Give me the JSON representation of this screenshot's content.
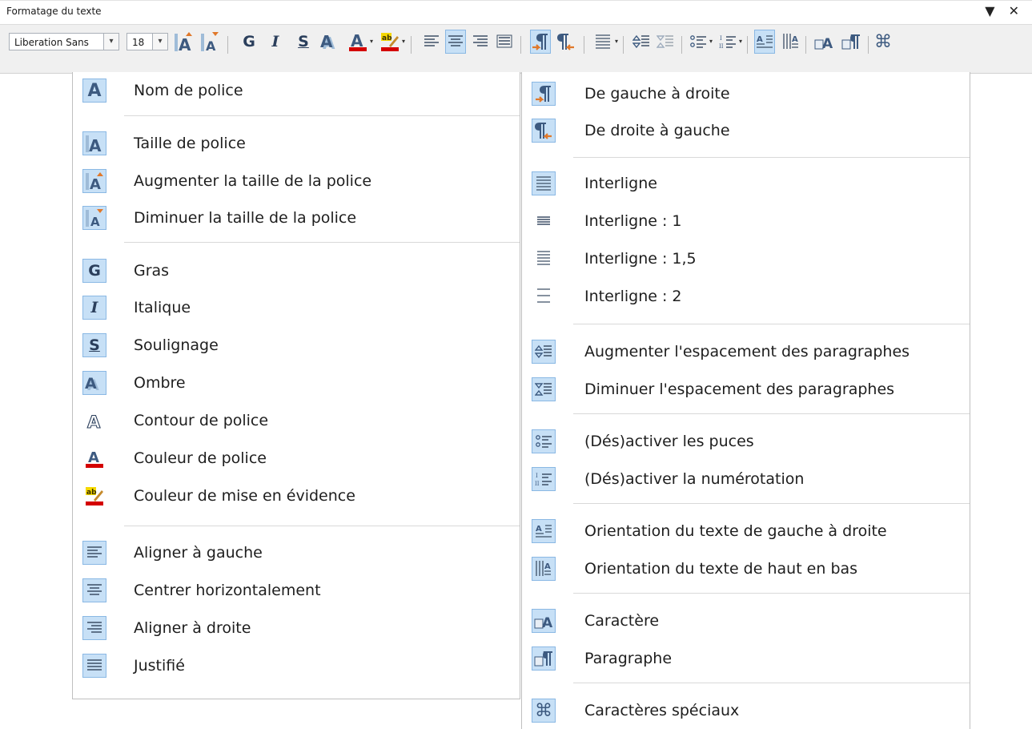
{
  "window": {
    "title": "Formatage du texte",
    "controls": "▼ ✕"
  },
  "toolbar": {
    "font_name": "Liberation Sans",
    "font_size": "18",
    "dropdown_glyph": "⌄",
    "bold": "G",
    "italic": "I",
    "underline": "S"
  },
  "colors": {
    "accent_bg": "#c7e0f6",
    "accent_border": "#8ab8e4",
    "icon": "#2b3f5c",
    "font_color_bar": "#d40000",
    "highlight": "#f5d800"
  },
  "left_menu": [
    {
      "label": "Nom de police",
      "icon": "font-name-icon"
    },
    {
      "label": "Taille de police",
      "icon": "font-size-icon"
    },
    {
      "label": "Augmenter la taille de la police",
      "icon": "grow-font-icon"
    },
    {
      "label": "Diminuer la taille de la police",
      "icon": "shrink-font-icon"
    },
    {
      "label": "Gras",
      "icon": "bold-icon"
    },
    {
      "label": "Italique",
      "icon": "italic-icon"
    },
    {
      "label": "Soulignage",
      "icon": "underline-icon"
    },
    {
      "label": "Ombre",
      "icon": "shadow-icon"
    },
    {
      "label": "Contour de police",
      "icon": "outline-font-icon"
    },
    {
      "label": "Couleur de police",
      "icon": "font-color-icon"
    },
    {
      "label": "Couleur de mise en évidence",
      "icon": "highlight-color-icon"
    },
    {
      "label": "Aligner à gauche",
      "icon": "align-left-icon"
    },
    {
      "label": "Centrer horizontalement",
      "icon": "align-center-icon"
    },
    {
      "label": "Aligner à droite",
      "icon": "align-right-icon"
    },
    {
      "label": "Justifié",
      "icon": "justify-icon"
    }
  ],
  "right_menu": [
    {
      "label": "De gauche à droite",
      "icon": "ltr-paragraph-icon"
    },
    {
      "label": "De droite à gauche",
      "icon": "rtl-paragraph-icon"
    },
    {
      "label": "Interligne",
      "icon": "line-spacing-icon"
    },
    {
      "label": "Interligne : 1",
      "icon": "line-spacing-1-icon"
    },
    {
      "label": "Interligne : 1,5",
      "icon": "line-spacing-15-icon"
    },
    {
      "label": "Interligne : 2",
      "icon": "line-spacing-2-icon"
    },
    {
      "label": "Augmenter l'espacement des paragraphes",
      "icon": "increase-paragraph-spacing-icon"
    },
    {
      "label": "Diminuer l'espacement des paragraphes",
      "icon": "decrease-paragraph-spacing-icon"
    },
    {
      "label": "(Dés)activer les puces",
      "icon": "bullets-icon"
    },
    {
      "label": "(Dés)activer la numérotation",
      "icon": "numbering-icon"
    },
    {
      "label": "Orientation du texte de gauche à droite",
      "icon": "text-direction-ltr-icon"
    },
    {
      "label": "Orientation du texte de haut en bas",
      "icon": "text-direction-ttb-icon"
    },
    {
      "label": "Caractère",
      "icon": "character-dialog-icon"
    },
    {
      "label": "Paragraphe",
      "icon": "paragraph-dialog-icon"
    },
    {
      "label": "Caractères spéciaux",
      "icon": "special-characters-icon"
    }
  ]
}
